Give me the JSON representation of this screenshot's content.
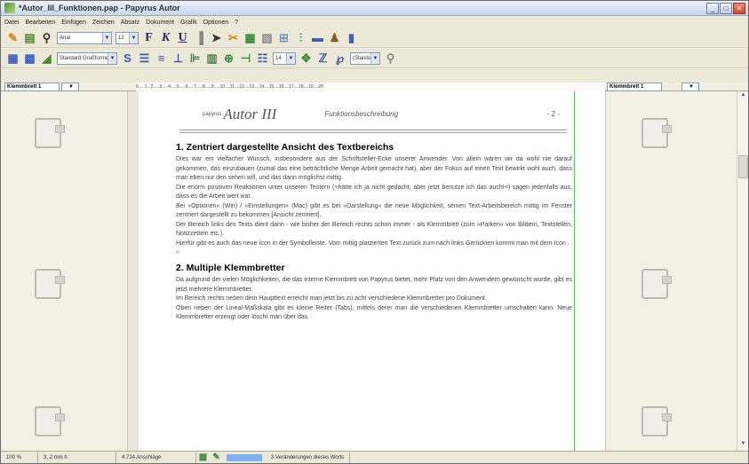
{
  "window": {
    "title": "*Autor_III_Funktionen.pap - Papyrus Autor"
  },
  "menu": [
    "Datei",
    "Bearbeiten",
    "Einfügen",
    "Zeichen",
    "Absatz",
    "Dokument",
    "Grafik",
    "Optionen",
    "?"
  ],
  "toolbar1": {
    "font": "Arial",
    "size": "12",
    "bold": "F",
    "italic": "K",
    "underline": "U"
  },
  "toolbar2": {
    "style": "Standard Grußformel",
    "size": "14",
    "color": "(Standard)"
  },
  "ruler": {
    "left_clip": "Klemmbrett 1",
    "right_clip": "Klemmbrett 1",
    "scale": "0.....1...2.....3.....4.....5.....6.....7.....8.....9.....10....11....12....13....14....15....16....17....18....19....20"
  },
  "header": {
    "small": "papyrus",
    "logo": "Autor III",
    "title": "Funktionsbeschreibung",
    "page": "- 2 -"
  },
  "sections": [
    {
      "heading": "1. Zentriert dargestellte Ansicht des Textbereichs",
      "paragraphs": [
        "Dies war ein vielfacher Wunsch, insbesondere aus der Schriftsteller-Ecke unserer Anwender. Von allein wären wir da wohl nie darauf gekommen, das einzubauen (zumal das eine beträchtliche Menge Arbeit gemacht hat), aber der Fokus auf einen Text bewirkt wohl auch, dass man eben nur den sehen will, und das dann möglichst mittig.",
        "Die enorm positiven Reaktionen unter unseren Testern (>hätte ich ja nicht gedacht, aber jetzt benutze ich das auch!<) sagen jedenfalls aus, dass es die Arbeit wert war.",
        "Bei »Optionen« (Win) / »Einstellungen« (Mac) gibt es bei »Darstellung« die neue Möglichkeit, seinen Text-Arbeitsbereich mittig im Fenster zentriert dargestellt zu bekommen [Ansicht zentriert].",
        "Der Bereich links des Texts dient dann - wie bisher der Bereich rechts schon immer - als Klemmbrett (zum »Parken« von Bildern, Textstellen, Notizzetteln etc.).",
        "Hierfür gibt es auch das neue Icon in der Symbolleiste. Vom mittig platzierten Text zurück zum nach links Gerückten kommt man mit dem Icon ."
      ]
    },
    {
      "heading": "2. Multiple Klemmbretter",
      "paragraphs": [
        "Da aufgrund der vielen Möglichkeiten, die das interne Klemmbrett von Papyrus bietet, mehr Platz von den Anwendern gewünscht wurde, gibt es jetzt mehrere Klemmbretter.",
        "Im Bereich rechts neben dem Haupttext erreicht man jetzt bis zu acht verschiedene Klemmbretter pro Dokument.",
        "Oben neben der Lineal-Maßskala gibt es kleine Reiter (Tabs), mittels derer man die verschiedenen Klemmbretter umschalten kann. Neue Klemmbretter erzeugt oder löscht man über das"
      ]
    }
  ],
  "status": {
    "zoom": "100 %",
    "position": "3, 2 mm h",
    "chars": "4.724 Anschläge",
    "changes": "3 Veränderungen dieses Worts"
  }
}
